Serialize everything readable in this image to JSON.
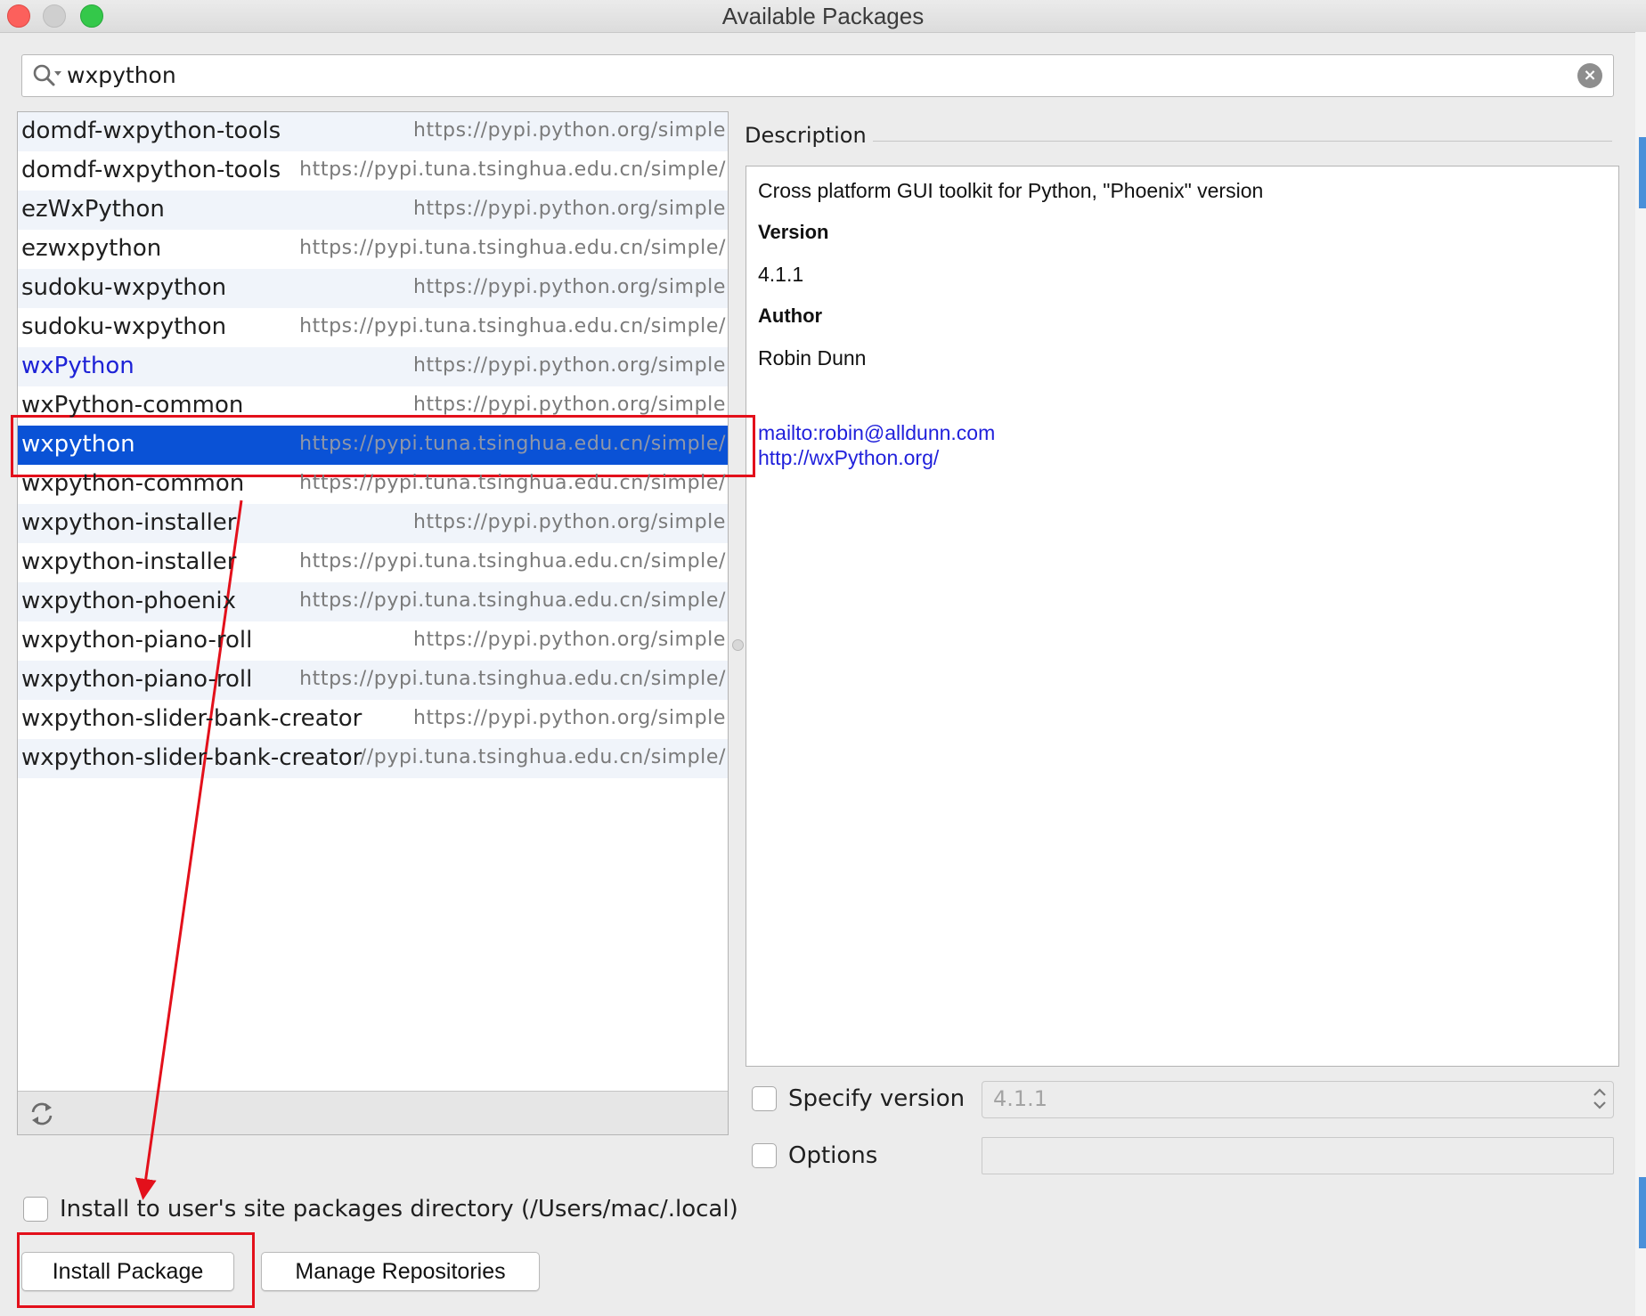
{
  "window": {
    "title": "Available Packages"
  },
  "search": {
    "value": "wxpython",
    "clear_icon": "×"
  },
  "packages": [
    {
      "name": "domdf-wxpython-tools",
      "repo": "https://pypi.python.org/simple"
    },
    {
      "name": "domdf-wxpython-tools",
      "repo": "https://pypi.tuna.tsinghua.edu.cn/simple/"
    },
    {
      "name": "ezWxPython",
      "repo": "https://pypi.python.org/simple"
    },
    {
      "name": "ezwxpython",
      "repo": "https://pypi.tuna.tsinghua.edu.cn/simple/"
    },
    {
      "name": "sudoku-wxpython",
      "repo": "https://pypi.python.org/simple"
    },
    {
      "name": "sudoku-wxpython",
      "repo": "https://pypi.tuna.tsinghua.edu.cn/simple/"
    },
    {
      "name": "wxPython",
      "repo": "https://pypi.python.org/simple",
      "installed": true
    },
    {
      "name": "wxPython-common",
      "repo": "https://pypi.python.org/simple"
    },
    {
      "name": "wxpython",
      "repo": "https://pypi.tuna.tsinghua.edu.cn/simple/",
      "selected": true
    },
    {
      "name": "wxpython-common",
      "repo": "https://pypi.tuna.tsinghua.edu.cn/simple/"
    },
    {
      "name": "wxpython-installer",
      "repo": "https://pypi.python.org/simple"
    },
    {
      "name": "wxpython-installer",
      "repo": "https://pypi.tuna.tsinghua.edu.cn/simple/"
    },
    {
      "name": "wxpython-phoenix",
      "repo": "https://pypi.tuna.tsinghua.edu.cn/simple/"
    },
    {
      "name": "wxpython-piano-roll",
      "repo": "https://pypi.python.org/simple"
    },
    {
      "name": "wxpython-piano-roll",
      "repo": "https://pypi.tuna.tsinghua.edu.cn/simple/"
    },
    {
      "name": "wxpython-slider-bank-creator",
      "repo": "https://pypi.python.org/simple"
    },
    {
      "name": "wxpython-slider-bank-creator",
      "repo": "//pypi.tuna.tsinghua.edu.cn/simple/"
    }
  ],
  "description": {
    "label": "Description",
    "summary": "Cross platform GUI toolkit for Python, \"Phoenix\" version",
    "version_heading": "Version",
    "version": "4.1.1",
    "author_heading": "Author",
    "author": "Robin Dunn",
    "email_link": "mailto:robin@alldunn.com",
    "url_link": "http://wxPython.org/"
  },
  "specify_version": {
    "label": "Specify version",
    "checked": false,
    "value": "4.1.1"
  },
  "options": {
    "label": "Options",
    "checked": false,
    "value": ""
  },
  "user_site": {
    "label": "Install to user's site packages directory (/Users/mac/.local)",
    "checked": false
  },
  "buttons": {
    "install": "Install Package",
    "manage": "Manage Repositories"
  },
  "icons": {
    "search": "search-icon",
    "clear": "clear-icon",
    "refresh": "refresh-icon",
    "stepper": "updown-stepper-icon"
  },
  "colors": {
    "selection": "#0a52d6",
    "installed_package": "#1d22d6",
    "link": "#1f1fdb",
    "annotation": "#e3101b",
    "traffic_close": "#fc605c",
    "traffic_max": "#34c84a"
  }
}
